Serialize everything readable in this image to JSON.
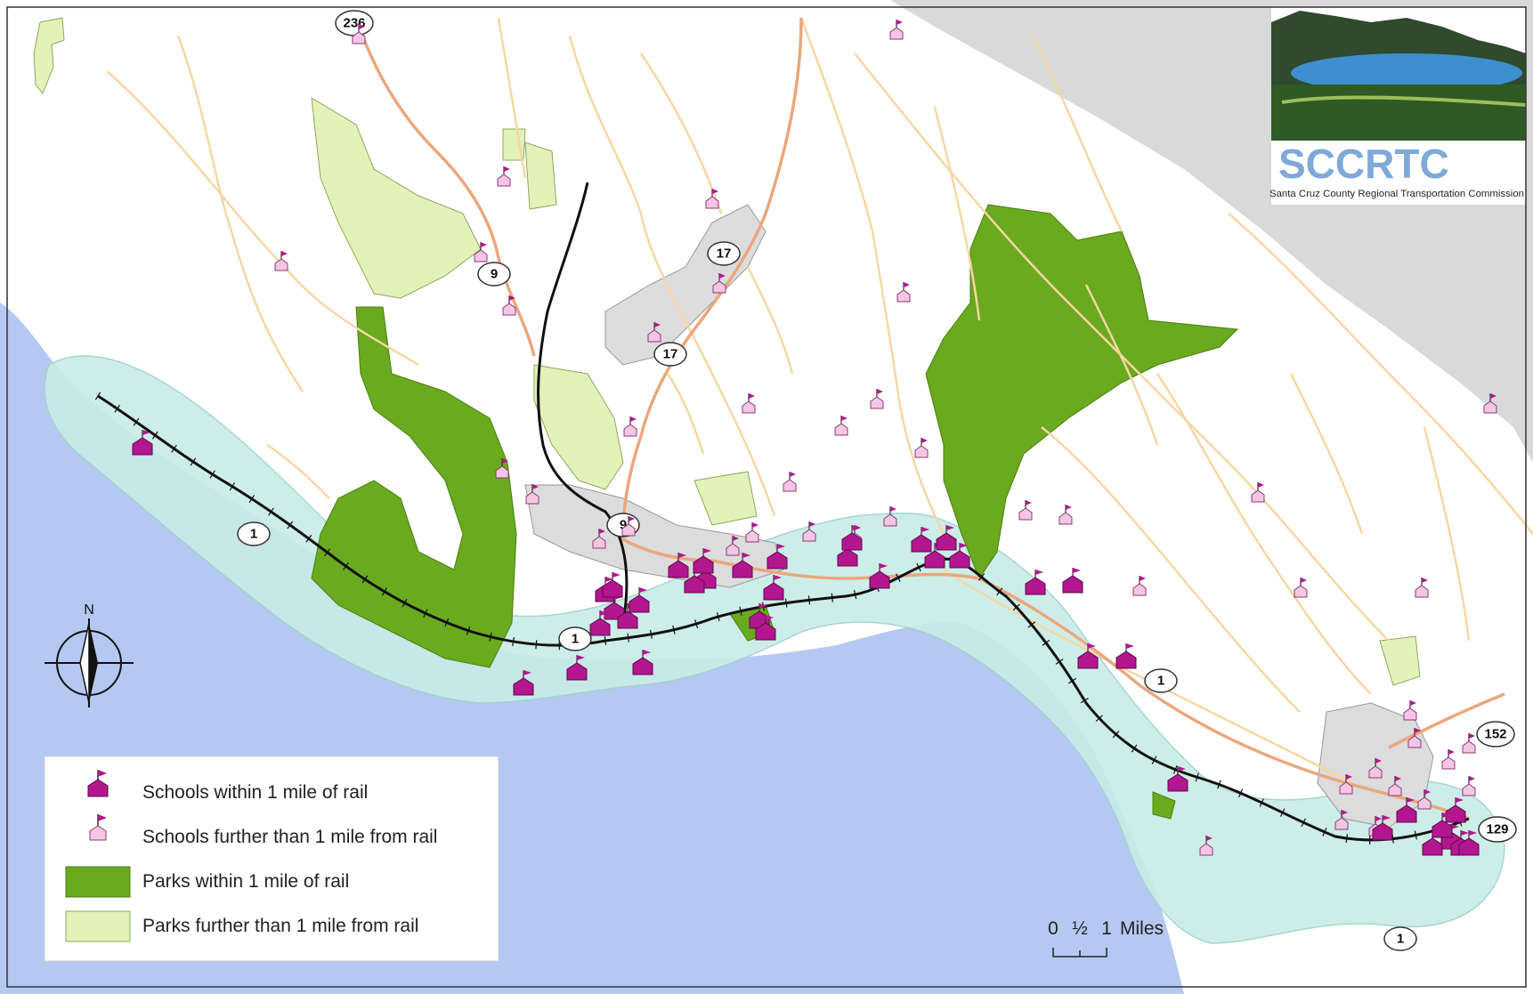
{
  "logo": {
    "acronym": "SCCRTC",
    "full_name": "Santa Cruz County Regional Transportation Commission"
  },
  "highways": [
    {
      "id": "hwy-236",
      "label": "236"
    },
    {
      "id": "hwy-9-north",
      "label": "9"
    },
    {
      "id": "hwy-17-north",
      "label": "17"
    },
    {
      "id": "hwy-17-south",
      "label": "17"
    },
    {
      "id": "hwy-9-south",
      "label": "9"
    },
    {
      "id": "hwy-1-west",
      "label": "1"
    },
    {
      "id": "hwy-1-santa-cruz",
      "label": "1"
    },
    {
      "id": "hwy-1-aptos",
      "label": "1"
    },
    {
      "id": "hwy-1-south",
      "label": "1"
    },
    {
      "id": "hwy-152",
      "label": "152"
    },
    {
      "id": "hwy-129",
      "label": "129"
    }
  ],
  "north_arrow": {
    "label": "N"
  },
  "legend": {
    "items": [
      {
        "label": "Schools within 1 mile of rail",
        "symbol": "school-near"
      },
      {
        "label": "Schools further than 1 mile from rail",
        "symbol": "school-far"
      },
      {
        "label": "Parks within 1 mile of rail",
        "symbol": "park-near"
      },
      {
        "label": "Parks further than 1 mile from rail",
        "symbol": "park-far"
      }
    ]
  },
  "scale_bar": {
    "tick_0": "0",
    "tick_half": "½",
    "tick_1": "1",
    "unit": "Miles"
  },
  "colors": {
    "ocean": "#b5c8f2",
    "land": "#ffffff",
    "outside": "#d9d9d9",
    "rail_buffer": "#c8ece6",
    "park_near": "#6aaa1e",
    "park_far": "#e2f2b8",
    "school_near": "#b3168f",
    "school_far": "#f4c6e4",
    "rail": "#111111",
    "roads": "#f6d7a3",
    "highway": "#eba77c",
    "urban": "#dcdcdc"
  }
}
